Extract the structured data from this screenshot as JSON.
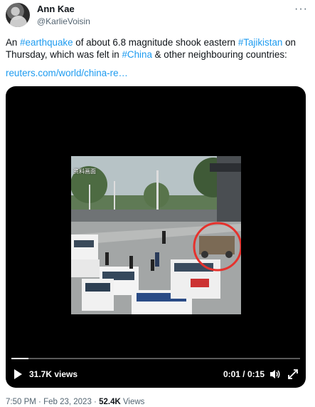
{
  "tweet": {
    "author_name": "Ann Kae",
    "author_handle": "@KarlieVoisin",
    "more_label": "···",
    "text_before": "An ",
    "tag1": "#earthquake",
    "text_mid1": " of about 6.8 magnitude shook eastern ",
    "tag2": "#Tajikistan",
    "text_mid2": " on Thursday, which was felt in ",
    "tag3": "#China",
    "text_after": " & other neighbouring countries:",
    "link": "reuters.com/world/china-re…"
  },
  "video": {
    "frame_caption": "资料画面",
    "views": "31.7K views",
    "time": "0:01 / 0:15",
    "progress": 0.06
  },
  "meta": {
    "time": "7:50 PM",
    "separator": " · ",
    "date": "Feb 23, 2023",
    "views_count": "52.4K",
    "views_label": " Views"
  },
  "icons": {
    "play": "play-icon",
    "volume": "volume-icon",
    "expand": "expand-icon",
    "more": "more-icon"
  },
  "colors": {
    "link": "#1d9bf0",
    "text": "#0f1419",
    "muted": "#536471",
    "highlight_circle": "#e5322d"
  }
}
